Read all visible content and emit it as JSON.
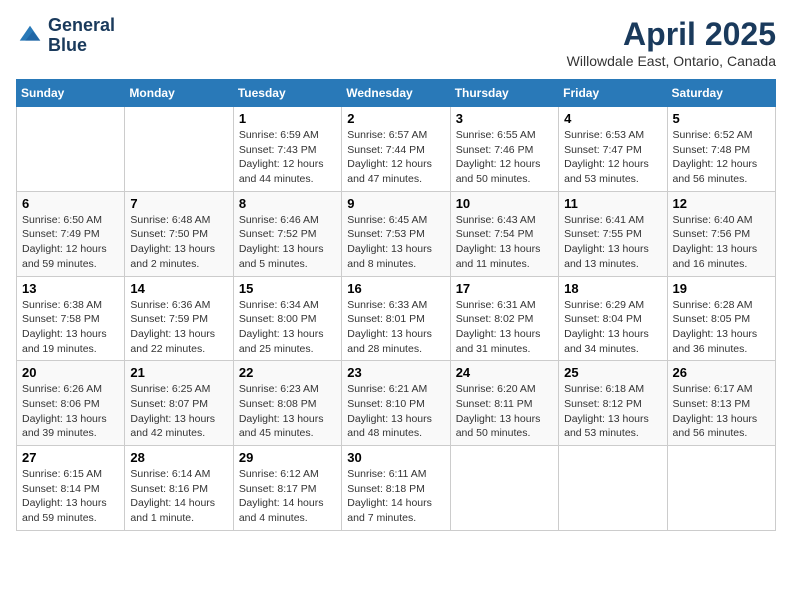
{
  "header": {
    "logo_line1": "General",
    "logo_line2": "Blue",
    "month": "April 2025",
    "location": "Willowdale East, Ontario, Canada"
  },
  "weekdays": [
    "Sunday",
    "Monday",
    "Tuesday",
    "Wednesday",
    "Thursday",
    "Friday",
    "Saturday"
  ],
  "weeks": [
    [
      {
        "day": "",
        "info": ""
      },
      {
        "day": "",
        "info": ""
      },
      {
        "day": "1",
        "info": "Sunrise: 6:59 AM\nSunset: 7:43 PM\nDaylight: 12 hours and 44 minutes."
      },
      {
        "day": "2",
        "info": "Sunrise: 6:57 AM\nSunset: 7:44 PM\nDaylight: 12 hours and 47 minutes."
      },
      {
        "day": "3",
        "info": "Sunrise: 6:55 AM\nSunset: 7:46 PM\nDaylight: 12 hours and 50 minutes."
      },
      {
        "day": "4",
        "info": "Sunrise: 6:53 AM\nSunset: 7:47 PM\nDaylight: 12 hours and 53 minutes."
      },
      {
        "day": "5",
        "info": "Sunrise: 6:52 AM\nSunset: 7:48 PM\nDaylight: 12 hours and 56 minutes."
      }
    ],
    [
      {
        "day": "6",
        "info": "Sunrise: 6:50 AM\nSunset: 7:49 PM\nDaylight: 12 hours and 59 minutes."
      },
      {
        "day": "7",
        "info": "Sunrise: 6:48 AM\nSunset: 7:50 PM\nDaylight: 13 hours and 2 minutes."
      },
      {
        "day": "8",
        "info": "Sunrise: 6:46 AM\nSunset: 7:52 PM\nDaylight: 13 hours and 5 minutes."
      },
      {
        "day": "9",
        "info": "Sunrise: 6:45 AM\nSunset: 7:53 PM\nDaylight: 13 hours and 8 minutes."
      },
      {
        "day": "10",
        "info": "Sunrise: 6:43 AM\nSunset: 7:54 PM\nDaylight: 13 hours and 11 minutes."
      },
      {
        "day": "11",
        "info": "Sunrise: 6:41 AM\nSunset: 7:55 PM\nDaylight: 13 hours and 13 minutes."
      },
      {
        "day": "12",
        "info": "Sunrise: 6:40 AM\nSunset: 7:56 PM\nDaylight: 13 hours and 16 minutes."
      }
    ],
    [
      {
        "day": "13",
        "info": "Sunrise: 6:38 AM\nSunset: 7:58 PM\nDaylight: 13 hours and 19 minutes."
      },
      {
        "day": "14",
        "info": "Sunrise: 6:36 AM\nSunset: 7:59 PM\nDaylight: 13 hours and 22 minutes."
      },
      {
        "day": "15",
        "info": "Sunrise: 6:34 AM\nSunset: 8:00 PM\nDaylight: 13 hours and 25 minutes."
      },
      {
        "day": "16",
        "info": "Sunrise: 6:33 AM\nSunset: 8:01 PM\nDaylight: 13 hours and 28 minutes."
      },
      {
        "day": "17",
        "info": "Sunrise: 6:31 AM\nSunset: 8:02 PM\nDaylight: 13 hours and 31 minutes."
      },
      {
        "day": "18",
        "info": "Sunrise: 6:29 AM\nSunset: 8:04 PM\nDaylight: 13 hours and 34 minutes."
      },
      {
        "day": "19",
        "info": "Sunrise: 6:28 AM\nSunset: 8:05 PM\nDaylight: 13 hours and 36 minutes."
      }
    ],
    [
      {
        "day": "20",
        "info": "Sunrise: 6:26 AM\nSunset: 8:06 PM\nDaylight: 13 hours and 39 minutes."
      },
      {
        "day": "21",
        "info": "Sunrise: 6:25 AM\nSunset: 8:07 PM\nDaylight: 13 hours and 42 minutes."
      },
      {
        "day": "22",
        "info": "Sunrise: 6:23 AM\nSunset: 8:08 PM\nDaylight: 13 hours and 45 minutes."
      },
      {
        "day": "23",
        "info": "Sunrise: 6:21 AM\nSunset: 8:10 PM\nDaylight: 13 hours and 48 minutes."
      },
      {
        "day": "24",
        "info": "Sunrise: 6:20 AM\nSunset: 8:11 PM\nDaylight: 13 hours and 50 minutes."
      },
      {
        "day": "25",
        "info": "Sunrise: 6:18 AM\nSunset: 8:12 PM\nDaylight: 13 hours and 53 minutes."
      },
      {
        "day": "26",
        "info": "Sunrise: 6:17 AM\nSunset: 8:13 PM\nDaylight: 13 hours and 56 minutes."
      }
    ],
    [
      {
        "day": "27",
        "info": "Sunrise: 6:15 AM\nSunset: 8:14 PM\nDaylight: 13 hours and 59 minutes."
      },
      {
        "day": "28",
        "info": "Sunrise: 6:14 AM\nSunset: 8:16 PM\nDaylight: 14 hours and 1 minute."
      },
      {
        "day": "29",
        "info": "Sunrise: 6:12 AM\nSunset: 8:17 PM\nDaylight: 14 hours and 4 minutes."
      },
      {
        "day": "30",
        "info": "Sunrise: 6:11 AM\nSunset: 8:18 PM\nDaylight: 14 hours and 7 minutes."
      },
      {
        "day": "",
        "info": ""
      },
      {
        "day": "",
        "info": ""
      },
      {
        "day": "",
        "info": ""
      }
    ]
  ]
}
